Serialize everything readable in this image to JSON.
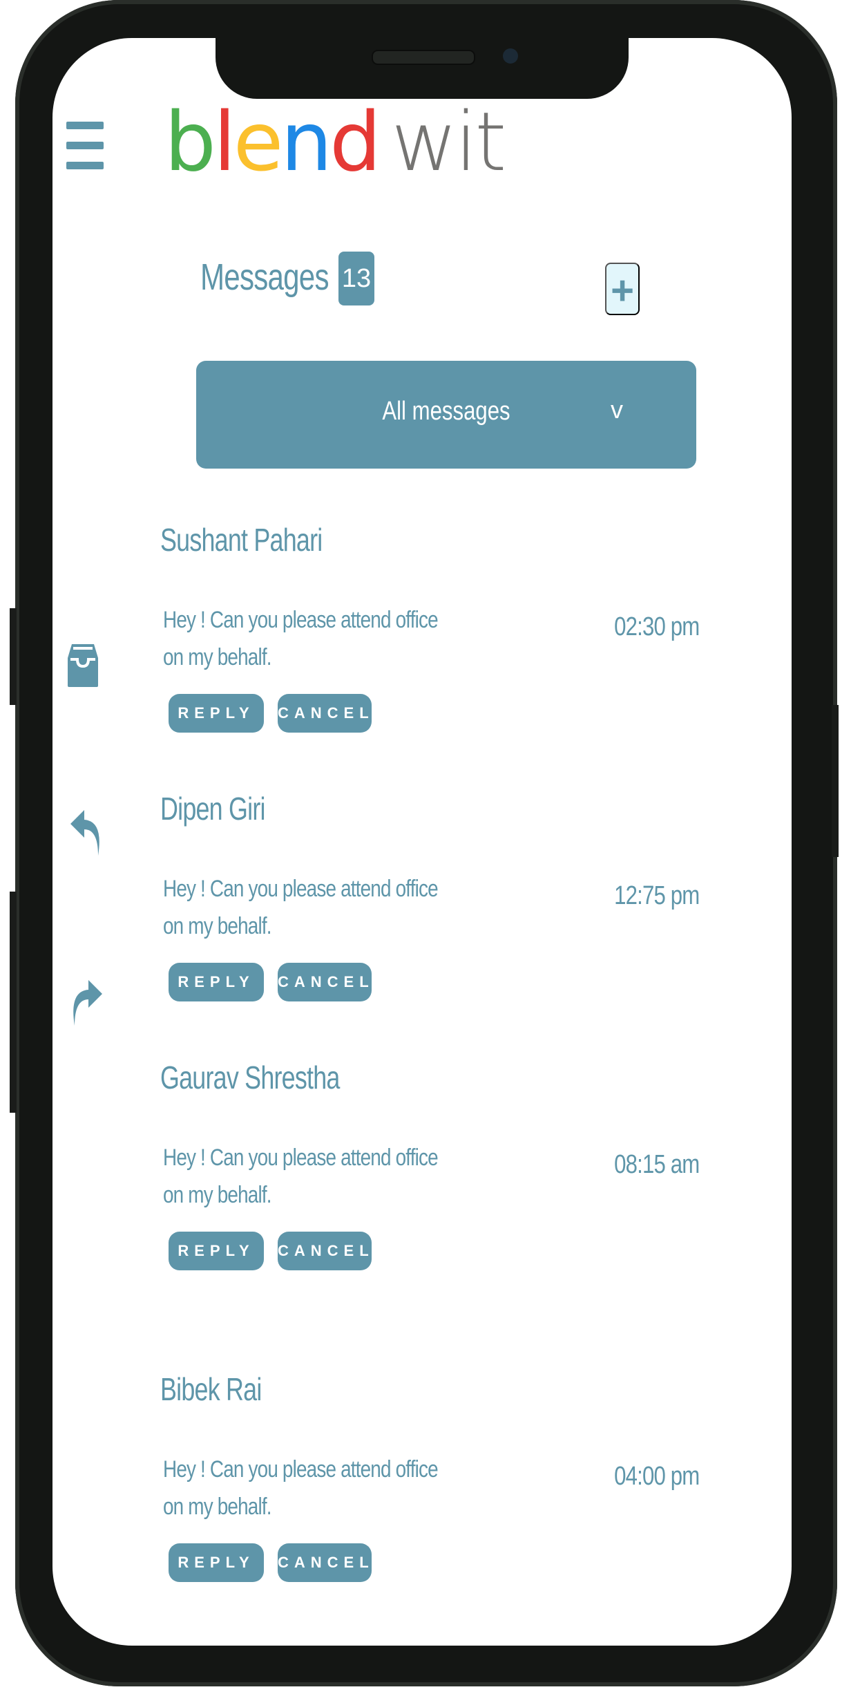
{
  "app": {
    "logo_part1": "blend",
    "logo_part2": "wit",
    "logo_colors": [
      "#4caf50",
      "#e53935",
      "#fbc02d",
      "#1e88e5",
      "#e53935"
    ]
  },
  "header": {
    "title": "Messages",
    "count": "13",
    "add_label": "+"
  },
  "filter": {
    "selected": "All messages",
    "chevron": "v"
  },
  "side_icons": [
    "inbox-icon",
    "reply-icon",
    "forward-icon"
  ],
  "messages": [
    {
      "sender": "Sushant Pahari",
      "body": "Hey ! Can you please attend office on my behalf.",
      "time": "02:30 pm",
      "reply": "REPLY",
      "cancel": "CANCEL"
    },
    {
      "sender": "Dipen Giri",
      "body": "Hey ! Can you please attend office on my behalf.",
      "time": "12:75 pm",
      "reply": "REPLY",
      "cancel": "CANCEL"
    },
    {
      "sender": "Gaurav Shrestha",
      "body": "Hey ! Can you please attend office on my behalf.",
      "time": "08:15 am",
      "reply": "REPLY",
      "cancel": "CANCEL"
    },
    {
      "sender": "Bibek Rai",
      "body": "Hey ! Can you please attend office on my behalf.",
      "time": "04:00 pm",
      "reply": "REPLY",
      "cancel": "CANCEL"
    }
  ],
  "colors": {
    "accent": "#5e95a9",
    "accent_light": "#e2f6fb",
    "frame": "#141614"
  }
}
